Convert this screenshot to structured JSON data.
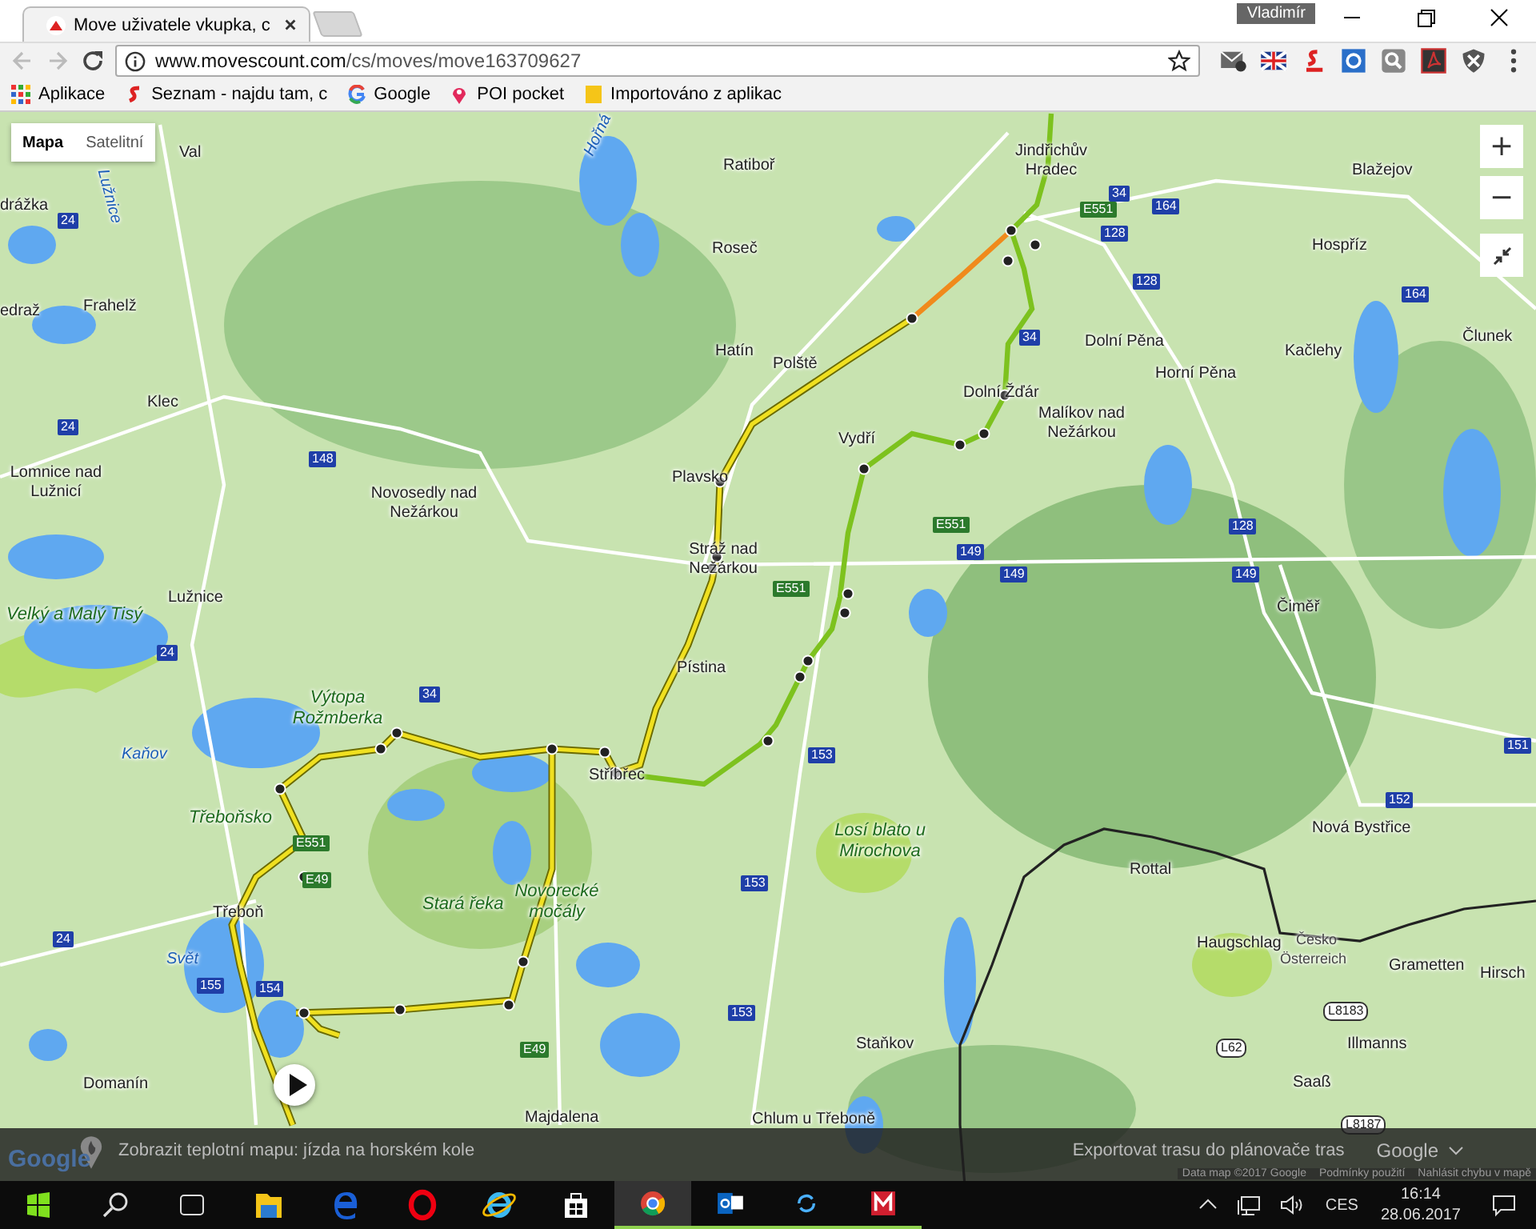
{
  "browser": {
    "tab_title": "Move uživatele vkupka, c",
    "user": "Vladimír",
    "url_host": "www.movescount.com",
    "url_path": "/cs/moves/move163709627",
    "bookmarks": [
      {
        "label": "Aplikace",
        "kind": "apps"
      },
      {
        "label": "Seznam - najdu tam, c",
        "kind": "seznam"
      },
      {
        "label": "Google",
        "kind": "google"
      },
      {
        "label": "POI pocket",
        "kind": "pin"
      },
      {
        "label": "Importováno z aplikac",
        "kind": "folder"
      }
    ]
  },
  "map": {
    "types": [
      {
        "label": "Mapa",
        "selected": true
      },
      {
        "label": "Satelitní",
        "selected": false
      }
    ],
    "zoom_in": "+",
    "zoom_out": "−",
    "places": [
      {
        "name": "Val",
        "kind": "town"
      },
      {
        "name": "Ratiboř",
        "kind": "town"
      },
      {
        "name": "drážka",
        "kind": "town"
      },
      {
        "name": "Jindřichův Hradec",
        "kind": "town"
      },
      {
        "name": "Blažejov",
        "kind": "town"
      },
      {
        "name": "Hospříz",
        "kind": "town"
      },
      {
        "name": "Roseč",
        "kind": "town"
      },
      {
        "name": "edraž",
        "kind": "town"
      },
      {
        "name": "Frahelž",
        "kind": "town"
      },
      {
        "name": "Hatín",
        "kind": "town"
      },
      {
        "name": "Polště",
        "kind": "town"
      },
      {
        "name": "Dolní Pěna",
        "kind": "town"
      },
      {
        "name": "Horní Pěna",
        "kind": "town"
      },
      {
        "name": "Kačlehy",
        "kind": "town"
      },
      {
        "name": "Člunek",
        "kind": "town"
      },
      {
        "name": "Klec",
        "kind": "town"
      },
      {
        "name": "Dolní Žďár",
        "kind": "town"
      },
      {
        "name": "Malíkov nad Nežárkou",
        "kind": "town"
      },
      {
        "name": "Vydří",
        "kind": "town"
      },
      {
        "name": "Lomnice nad Lužnicí",
        "kind": "town"
      },
      {
        "name": "Novosedly nad Nežárkou",
        "kind": "town"
      },
      {
        "name": "Plavsko",
        "kind": "town"
      },
      {
        "name": "Stráž nad Nežárkou",
        "kind": "town"
      },
      {
        "name": "Lužnice",
        "kind": "town"
      },
      {
        "name": "Velký a Malý Tisý",
        "kind": "nature"
      },
      {
        "name": "Čiměř",
        "kind": "town"
      },
      {
        "name": "Pístina",
        "kind": "town"
      },
      {
        "name": "Výtopa Rožmberka",
        "kind": "nature"
      },
      {
        "name": "Kaňov",
        "kind": "water"
      },
      {
        "name": "Stříbřec",
        "kind": "town"
      },
      {
        "name": "Třeboňsko",
        "kind": "nature"
      },
      {
        "name": "Losí blato u Mirochova",
        "kind": "nature"
      },
      {
        "name": "Rottal",
        "kind": "town"
      },
      {
        "name": "Nová Bystřice",
        "kind": "town"
      },
      {
        "name": "Třeboň",
        "kind": "town"
      },
      {
        "name": "Stará řeka",
        "kind": "nature"
      },
      {
        "name": "Novorecké močály",
        "kind": "nature"
      },
      {
        "name": "Haugschlag",
        "kind": "town"
      },
      {
        "name": "Česko",
        "kind": "border"
      },
      {
        "name": "Österreich",
        "kind": "border"
      },
      {
        "name": "Grametten",
        "kind": "town"
      },
      {
        "name": "Hirsch",
        "kind": "town"
      },
      {
        "name": "Svět",
        "kind": "water"
      },
      {
        "name": "Staňkov",
        "kind": "town"
      },
      {
        "name": "Illmanns",
        "kind": "town"
      },
      {
        "name": "Domanín",
        "kind": "town"
      },
      {
        "name": "Saaß",
        "kind": "town"
      },
      {
        "name": "Majdalena",
        "kind": "town"
      },
      {
        "name": "Chlum u Třeboně",
        "kind": "town"
      },
      {
        "name": "Hořná",
        "kind": "water"
      },
      {
        "name": "Lužnice",
        "kind": "water"
      }
    ],
    "roads": [
      {
        "number": "E551",
        "kind": "euro"
      },
      {
        "number": "34",
        "kind": "national"
      },
      {
        "number": "128",
        "kind": "national"
      },
      {
        "number": "164",
        "kind": "national"
      },
      {
        "number": "128",
        "kind": "national"
      },
      {
        "number": "164",
        "kind": "national"
      },
      {
        "number": "24",
        "kind": "national"
      },
      {
        "number": "24",
        "kind": "national"
      },
      {
        "number": "148",
        "kind": "national"
      },
      {
        "number": "34",
        "kind": "national"
      },
      {
        "number": "E551",
        "kind": "euro"
      },
      {
        "number": "E551",
        "kind": "euro"
      },
      {
        "number": "149",
        "kind": "national"
      },
      {
        "number": "149",
        "kind": "national"
      },
      {
        "number": "128",
        "kind": "national"
      },
      {
        "number": "149",
        "kind": "national"
      },
      {
        "number": "24",
        "kind": "national"
      },
      {
        "number": "34",
        "kind": "national"
      },
      {
        "number": "153",
        "kind": "national"
      },
      {
        "number": "151",
        "kind": "national"
      },
      {
        "number": "152",
        "kind": "national"
      },
      {
        "number": "E551",
        "kind": "euro"
      },
      {
        "number": "E49",
        "kind": "euro"
      },
      {
        "number": "153",
        "kind": "national"
      },
      {
        "number": "24",
        "kind": "national"
      },
      {
        "number": "154",
        "kind": "national"
      },
      {
        "number": "155",
        "kind": "national"
      },
      {
        "number": "L8183",
        "kind": "local"
      },
      {
        "number": "153",
        "kind": "national"
      },
      {
        "number": "L62",
        "kind": "local"
      },
      {
        "number": "E49",
        "kind": "euro"
      },
      {
        "number": "L8187",
        "kind": "local"
      }
    ],
    "overlay": {
      "heatmap_link": "Zobrazit teplotní mapu: jízda na horském kole",
      "export_link": "Exportovat trasu do plánovače tras",
      "brand_menu": "Google",
      "logo": "Google",
      "attribution": "Data map ©2017 Google",
      "terms": "Podmínky použití",
      "report": "Nahlásit chybu v mapě"
    }
  },
  "taskbar": {
    "language": "CES",
    "time": "16:14",
    "date": "28.06.2017"
  }
}
